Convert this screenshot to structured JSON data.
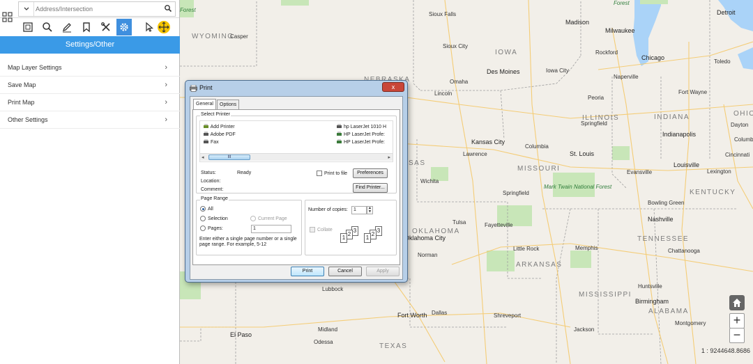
{
  "search": {
    "placeholder": "Address/Intersection"
  },
  "panel": {
    "title": "Settings/Other",
    "menu": [
      {
        "label": "Map Layer Settings"
      },
      {
        "label": "Save Map"
      },
      {
        "label": "Print Map"
      },
      {
        "label": "Other Settings"
      }
    ]
  },
  "toolbar": {
    "tools": [
      "map-layers-icon",
      "search-icon",
      "pencil-icon",
      "bookmark-icon",
      "tools-icon",
      "gear-icon",
      "pointer-icon",
      "pan-icon"
    ],
    "active": "gear-icon"
  },
  "map": {
    "scale": "1 : 9244648.8686",
    "labels": {
      "states": [
        "WYOMING",
        "NEBRASKA",
        "IOWA",
        "ILLINOIS",
        "INDIANA",
        "OHIO",
        "MISSOURI",
        "KENTUCKY",
        "OKLAHOMA",
        "TENNESSEE",
        "ARKANSAS",
        "MISSISSIPPI",
        "ALABAMA",
        "TEXAS",
        "SAS"
      ],
      "cities": [
        "Sioux Falls",
        "Madison",
        "Milwaukee",
        "Detroit",
        "Sioux City",
        "Rockford",
        "Chicago",
        "Toledo",
        "Des Moines",
        "Iowa City",
        "Naperville",
        "Omaha",
        "Lincoln",
        "Peoria",
        "Fort Wayne",
        "Columbus",
        "Indianapolis",
        "Springfield",
        "Cincinnati",
        "Dayton",
        "Kansas City",
        "Lawrence",
        "Columbia",
        "St. Louis",
        "Evansville",
        "Louisville",
        "Lexington",
        "Wichita",
        "Springfield",
        "Bowling Green",
        "Nashville",
        "Tulsa",
        "Fayetteville",
        "Oklahoma City",
        "Memphis",
        "Chattanooga",
        "Norman",
        "Little Rock",
        "Huntsville",
        "Birmingham",
        "Lubbock",
        "Jackson",
        "Montgomery",
        "Fort Worth",
        "Dallas",
        "Shreveport",
        "Midland",
        "El Paso",
        "Odessa",
        "Casper"
      ],
      "forests": [
        "Forest",
        "Forest",
        "Mark Twain National Forest"
      ]
    }
  },
  "dialog": {
    "title": "Print",
    "tabs": [
      "General",
      "Options"
    ],
    "select_printer": {
      "title": "Select Printer",
      "printers_left": [
        "Add Printer",
        "Adobe PDF",
        "Fax"
      ],
      "printers_right": [
        "hp LaserJet 1010 H",
        "HP LaserJet Profe:",
        "HP LaserJet Profe:"
      ],
      "scroll_thumb": "III",
      "status_label": "Status:",
      "status_value": "Ready",
      "location_label": "Location:",
      "comment_label": "Comment:",
      "print_to_file": "Print to file",
      "preferences": "Preferences",
      "find_printer": "Find Printer..."
    },
    "page_range": {
      "title": "Page Range",
      "all": "All",
      "selection": "Selection",
      "current_page": "Current Page",
      "pages": "Pages:",
      "pages_value": "1",
      "hint": "Enter either a single page number or a single page range.  For example, 5-12"
    },
    "copies": {
      "label": "Number of copies:",
      "value": "1",
      "collate": "Collate",
      "collate_pages": [
        "1",
        "2",
        "3",
        "1",
        "2",
        "3"
      ]
    },
    "buttons": {
      "print": "Print",
      "cancel": "Cancel",
      "apply": "Apply"
    },
    "close": "x"
  }
}
